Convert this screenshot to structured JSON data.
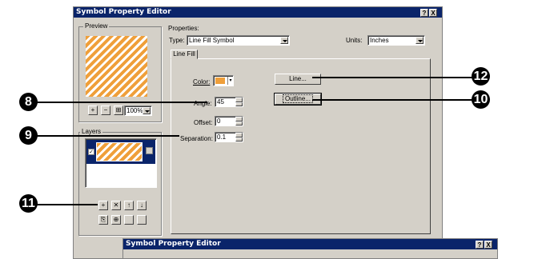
{
  "window": {
    "title": "Symbol Property Editor",
    "help_btn": "?",
    "close_btn": "X"
  },
  "preview": {
    "label": "Preview",
    "zoom": "100%"
  },
  "layers": {
    "label": "Layers"
  },
  "properties": {
    "label": "Properties:",
    "type_label": "Type:",
    "type_value": "Line Fill Symbol",
    "units_label": "Units:",
    "units_value": "Inches",
    "tab": "Line Fill",
    "color_label": "Color:",
    "angle_label": "Angle:",
    "angle_value": "45",
    "offset_label": "Offset:",
    "offset_value": "0",
    "separation_label": "Separation:",
    "separation_value": "0.1",
    "line_button": "Line...",
    "outline_button": "Outline..."
  },
  "callouts": {
    "c8": "8",
    "c9": "9",
    "c10": "10",
    "c11": "11",
    "c12": "12"
  },
  "second_window": {
    "title": "Symbol Property Editor",
    "help_btn": "?",
    "close_btn": "X"
  },
  "colors": {
    "accent_orange": "#ef9f3a",
    "titlebar": "#0a246a",
    "selection": "#0a246a"
  }
}
